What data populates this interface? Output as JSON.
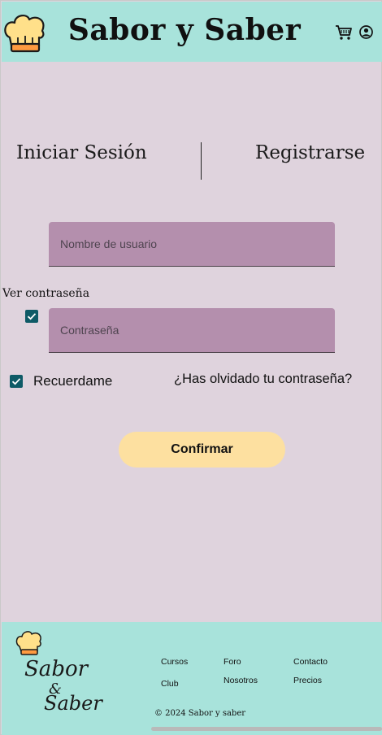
{
  "header": {
    "title": "Sabor y Saber",
    "logo_icon": "chef-hat-icon",
    "cart_icon": "shopping-cart-icon",
    "user_icon": "user-account-icon"
  },
  "tabs": [
    {
      "label": "Iniciar Sesión",
      "active": true
    },
    {
      "label": "Registrarse",
      "active": false
    }
  ],
  "form": {
    "username": {
      "placeholder": "Nombre de usuario",
      "value": ""
    },
    "show_password": {
      "label": "Ver contraseña",
      "checked": true
    },
    "password": {
      "placeholder": "Contraseña",
      "value": ""
    },
    "remember": {
      "label": "Recuerdame",
      "checked": true
    },
    "forgot_link": "¿Has olvidado tu contraseña?",
    "confirm_label": "Confirmar"
  },
  "footer": {
    "links": {
      "cursos": "Cursos",
      "club": "Club",
      "foro": "Foro",
      "nosotros": "Nosotros",
      "contacto": "Contacto",
      "precios": "Precios"
    },
    "copyright": "© 2024 Sabor y saber",
    "logo_line1": "Sabor",
    "logo_line2": "&",
    "logo_line3": "Saber"
  },
  "colors": {
    "header_bg": "#a8e3db",
    "page_bg": "#dfd3dd",
    "input_bg": "#b48fad",
    "checkbox": "#0e5a66",
    "button_bg": "#fde0a0"
  }
}
